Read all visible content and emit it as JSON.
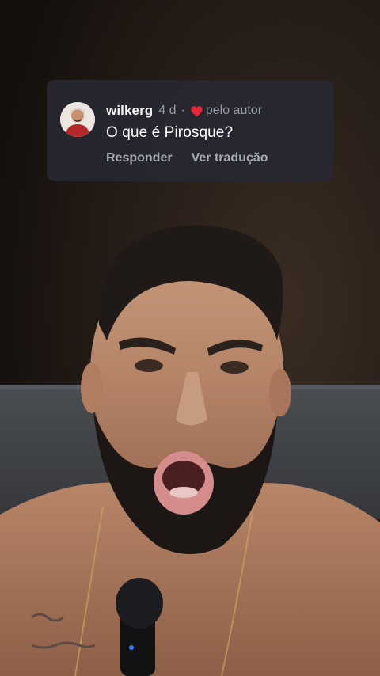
{
  "comment": {
    "username": "wilkerg",
    "age": "4 d",
    "separator": "·",
    "liked_by_author_label": "pelo autor",
    "heart_icon": "heart-icon",
    "heart_color": "#e8263a",
    "text": "O que é Pirosque?",
    "reply_label": "Responder",
    "translate_label": "Ver tradução"
  },
  "video": {
    "description": "man speaking into microphone"
  }
}
